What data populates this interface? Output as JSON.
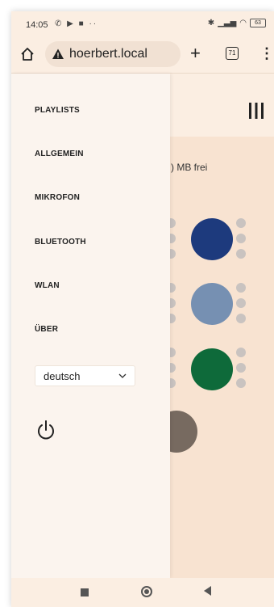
{
  "status_bar": {
    "time": "14:05",
    "left_icons": "✆ ▶ ■ ··",
    "battery": "63"
  },
  "browser": {
    "url": "hoerbert.local",
    "tab_count": "71"
  },
  "drawer": {
    "items": [
      {
        "label": "PLAYLISTS"
      },
      {
        "label": "ALLGEMEIN"
      },
      {
        "label": "MIKROFON"
      },
      {
        "label": "BLUETOOTH"
      },
      {
        "label": "WLAN"
      },
      {
        "label": "ÜBER"
      }
    ],
    "language": {
      "selected": "deutsch"
    }
  },
  "main": {
    "storage_text": ") MB frei"
  },
  "colors": {
    "background": "#fbeee2",
    "drawer": "#fbf4ee",
    "content_panel": "#f8e3d1",
    "circle_dark_blue": "#1d3a7d",
    "circle_light_blue": "#7690b2",
    "circle_green": "#0e6a3a",
    "circle_brown": "#776a60",
    "mini_icon": "#c9c3c0"
  }
}
